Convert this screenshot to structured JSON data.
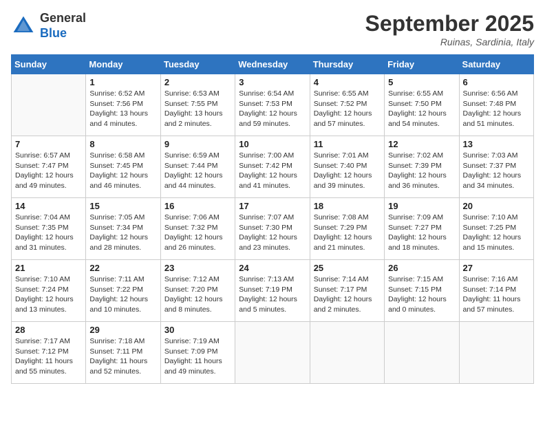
{
  "header": {
    "logo_line1": "General",
    "logo_line2": "Blue",
    "month_title": "September 2025",
    "location": "Ruinas, Sardinia, Italy"
  },
  "days_of_week": [
    "Sunday",
    "Monday",
    "Tuesday",
    "Wednesday",
    "Thursday",
    "Friday",
    "Saturday"
  ],
  "weeks": [
    [
      {
        "day": "",
        "info": ""
      },
      {
        "day": "1",
        "info": "Sunrise: 6:52 AM\nSunset: 7:56 PM\nDaylight: 13 hours\nand 4 minutes."
      },
      {
        "day": "2",
        "info": "Sunrise: 6:53 AM\nSunset: 7:55 PM\nDaylight: 13 hours\nand 2 minutes."
      },
      {
        "day": "3",
        "info": "Sunrise: 6:54 AM\nSunset: 7:53 PM\nDaylight: 12 hours\nand 59 minutes."
      },
      {
        "day": "4",
        "info": "Sunrise: 6:55 AM\nSunset: 7:52 PM\nDaylight: 12 hours\nand 57 minutes."
      },
      {
        "day": "5",
        "info": "Sunrise: 6:55 AM\nSunset: 7:50 PM\nDaylight: 12 hours\nand 54 minutes."
      },
      {
        "day": "6",
        "info": "Sunrise: 6:56 AM\nSunset: 7:48 PM\nDaylight: 12 hours\nand 51 minutes."
      }
    ],
    [
      {
        "day": "7",
        "info": "Sunrise: 6:57 AM\nSunset: 7:47 PM\nDaylight: 12 hours\nand 49 minutes."
      },
      {
        "day": "8",
        "info": "Sunrise: 6:58 AM\nSunset: 7:45 PM\nDaylight: 12 hours\nand 46 minutes."
      },
      {
        "day": "9",
        "info": "Sunrise: 6:59 AM\nSunset: 7:44 PM\nDaylight: 12 hours\nand 44 minutes."
      },
      {
        "day": "10",
        "info": "Sunrise: 7:00 AM\nSunset: 7:42 PM\nDaylight: 12 hours\nand 41 minutes."
      },
      {
        "day": "11",
        "info": "Sunrise: 7:01 AM\nSunset: 7:40 PM\nDaylight: 12 hours\nand 39 minutes."
      },
      {
        "day": "12",
        "info": "Sunrise: 7:02 AM\nSunset: 7:39 PM\nDaylight: 12 hours\nand 36 minutes."
      },
      {
        "day": "13",
        "info": "Sunrise: 7:03 AM\nSunset: 7:37 PM\nDaylight: 12 hours\nand 34 minutes."
      }
    ],
    [
      {
        "day": "14",
        "info": "Sunrise: 7:04 AM\nSunset: 7:35 PM\nDaylight: 12 hours\nand 31 minutes."
      },
      {
        "day": "15",
        "info": "Sunrise: 7:05 AM\nSunset: 7:34 PM\nDaylight: 12 hours\nand 28 minutes."
      },
      {
        "day": "16",
        "info": "Sunrise: 7:06 AM\nSunset: 7:32 PM\nDaylight: 12 hours\nand 26 minutes."
      },
      {
        "day": "17",
        "info": "Sunrise: 7:07 AM\nSunset: 7:30 PM\nDaylight: 12 hours\nand 23 minutes."
      },
      {
        "day": "18",
        "info": "Sunrise: 7:08 AM\nSunset: 7:29 PM\nDaylight: 12 hours\nand 21 minutes."
      },
      {
        "day": "19",
        "info": "Sunrise: 7:09 AM\nSunset: 7:27 PM\nDaylight: 12 hours\nand 18 minutes."
      },
      {
        "day": "20",
        "info": "Sunrise: 7:10 AM\nSunset: 7:25 PM\nDaylight: 12 hours\nand 15 minutes."
      }
    ],
    [
      {
        "day": "21",
        "info": "Sunrise: 7:10 AM\nSunset: 7:24 PM\nDaylight: 12 hours\nand 13 minutes."
      },
      {
        "day": "22",
        "info": "Sunrise: 7:11 AM\nSunset: 7:22 PM\nDaylight: 12 hours\nand 10 minutes."
      },
      {
        "day": "23",
        "info": "Sunrise: 7:12 AM\nSunset: 7:20 PM\nDaylight: 12 hours\nand 8 minutes."
      },
      {
        "day": "24",
        "info": "Sunrise: 7:13 AM\nSunset: 7:19 PM\nDaylight: 12 hours\nand 5 minutes."
      },
      {
        "day": "25",
        "info": "Sunrise: 7:14 AM\nSunset: 7:17 PM\nDaylight: 12 hours\nand 2 minutes."
      },
      {
        "day": "26",
        "info": "Sunrise: 7:15 AM\nSunset: 7:15 PM\nDaylight: 12 hours\nand 0 minutes."
      },
      {
        "day": "27",
        "info": "Sunrise: 7:16 AM\nSunset: 7:14 PM\nDaylight: 11 hours\nand 57 minutes."
      }
    ],
    [
      {
        "day": "28",
        "info": "Sunrise: 7:17 AM\nSunset: 7:12 PM\nDaylight: 11 hours\nand 55 minutes."
      },
      {
        "day": "29",
        "info": "Sunrise: 7:18 AM\nSunset: 7:11 PM\nDaylight: 11 hours\nand 52 minutes."
      },
      {
        "day": "30",
        "info": "Sunrise: 7:19 AM\nSunset: 7:09 PM\nDaylight: 11 hours\nand 49 minutes."
      },
      {
        "day": "",
        "info": ""
      },
      {
        "day": "",
        "info": ""
      },
      {
        "day": "",
        "info": ""
      },
      {
        "day": "",
        "info": ""
      }
    ]
  ]
}
